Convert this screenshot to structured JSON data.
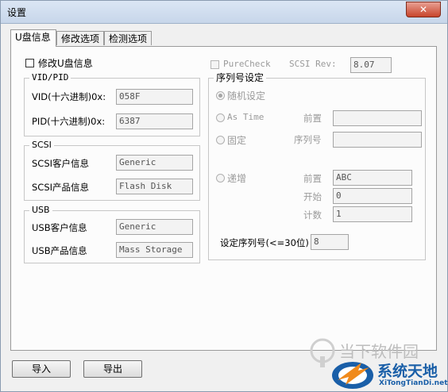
{
  "window": {
    "title": "设置",
    "close_glyph": "✕"
  },
  "tabs": [
    {
      "label": "U盘信息",
      "active": true
    },
    {
      "label": "修改选项",
      "active": false
    },
    {
      "label": "检测选项",
      "active": false
    }
  ],
  "modify_udisk": {
    "label": "修改U盘信息",
    "checked": false
  },
  "vidpid": {
    "title": "VID/PID",
    "vid_label": "VID(十六进制)0x:",
    "vid_value": "058F",
    "pid_label": "PID(十六进制)0x:",
    "pid_value": "6387"
  },
  "scsi": {
    "title": "SCSI",
    "customer_label": "SCSI客户信息",
    "customer_value": "Generic",
    "product_label": "SCSI产品信息",
    "product_value": "Flash Disk"
  },
  "usb": {
    "title": "USB",
    "customer_label": "USB客户信息",
    "customer_value": "Generic",
    "product_label": "USB产品信息",
    "product_value": "Mass Storage"
  },
  "purecheck": {
    "label": "PureCheck",
    "checked": false
  },
  "scsi_rev": {
    "label": "SCSI Rev:",
    "value": "8.07"
  },
  "serial": {
    "title": "序列号设定",
    "random_label": "随机设定",
    "astime_label": "As Time",
    "astime_prefix_label": "前置",
    "astime_prefix_value": "",
    "fixed_label": "固定",
    "fixed_serial_label": "序列号",
    "fixed_serial_value": "",
    "increment_label": "递增",
    "inc_prefix_label": "前置",
    "inc_prefix_value": "ABC",
    "inc_start_label": "开始",
    "inc_start_value": "0",
    "inc_count_label": "计数",
    "inc_count_value": "1",
    "length_label": "设定序列号(<=30位)",
    "length_value": "8",
    "selected": "random"
  },
  "buttons": {
    "import": "导入",
    "export": "导出"
  },
  "watermark": {
    "text": "当下软件园",
    "brand": "系统天地",
    "site": "XiTongTianDi.net"
  }
}
